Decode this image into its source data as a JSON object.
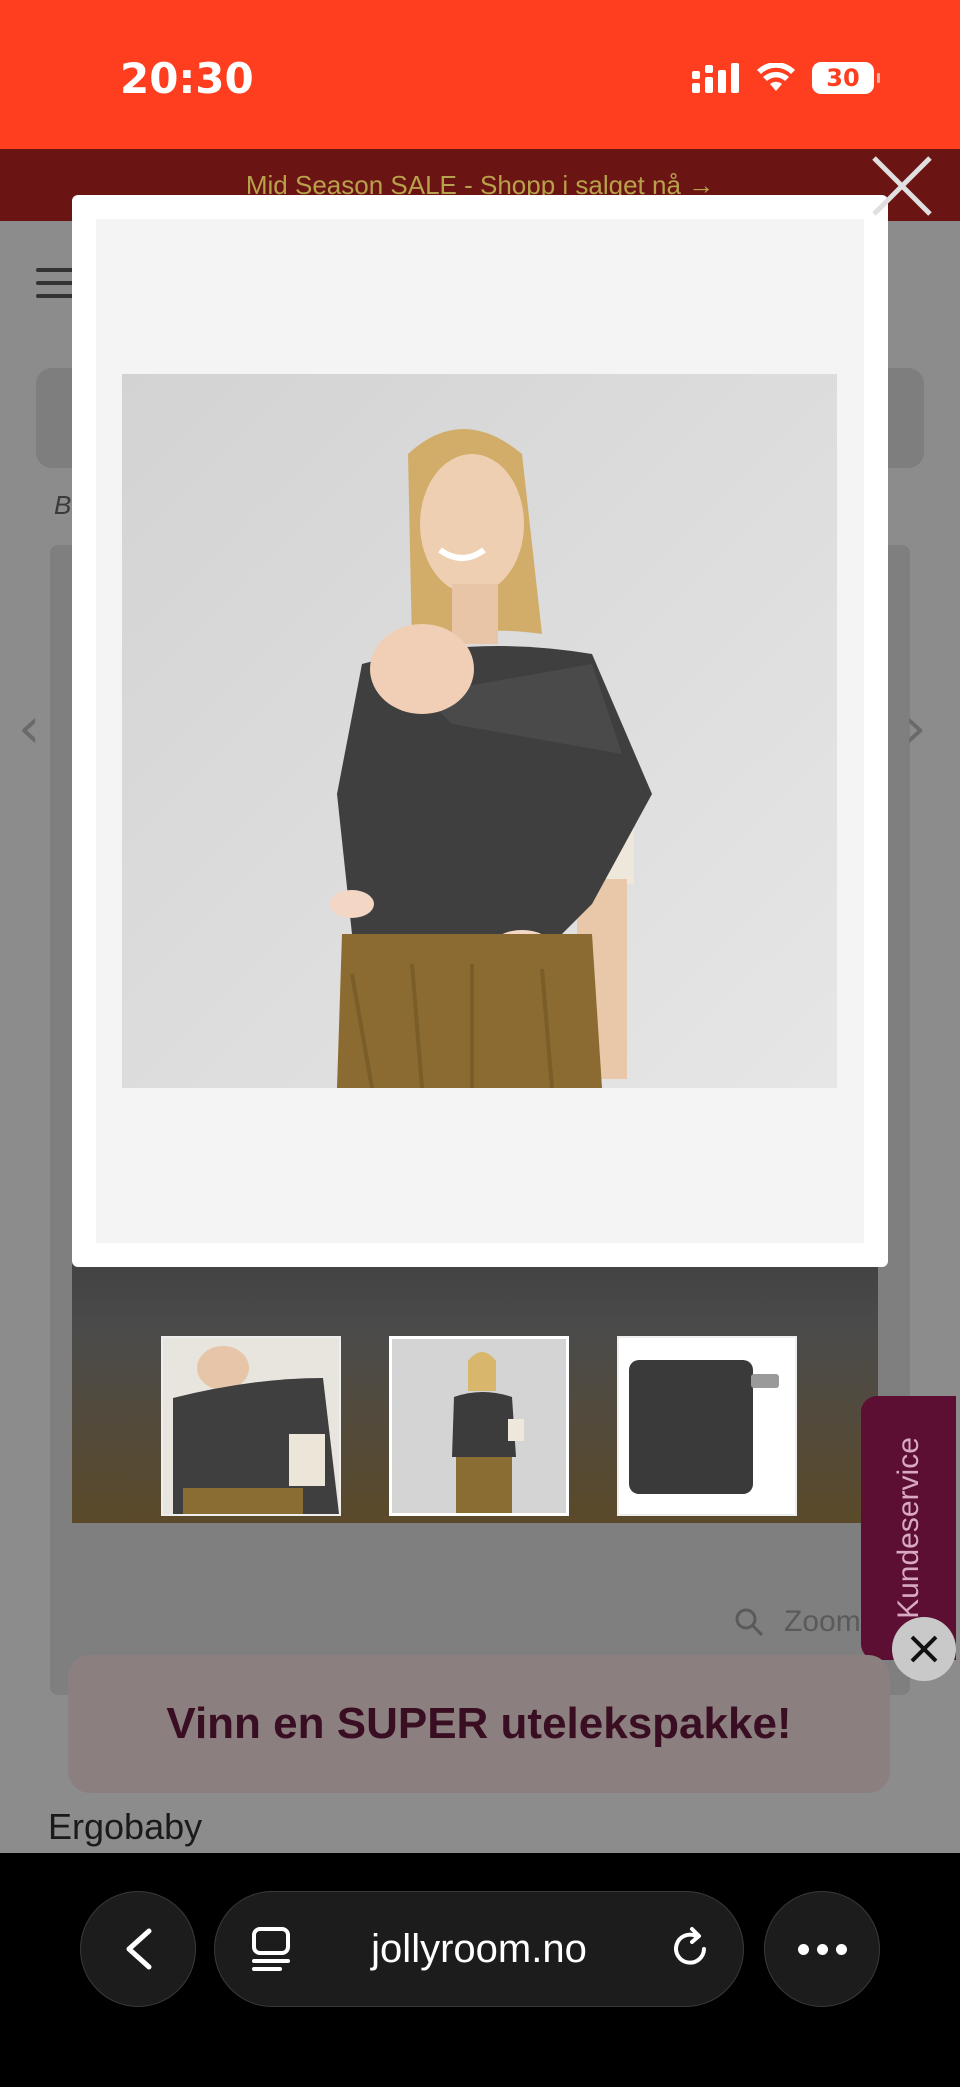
{
  "status_bar": {
    "time": "20:30",
    "battery": "30",
    "icons": [
      "signal-icon",
      "wifi-icon",
      "battery-icon"
    ],
    "color": "#ff3d1f"
  },
  "promo_banner": {
    "text": "Mid Season SALE - Shopp i salget nå →"
  },
  "page": {
    "breadcrumb": "B",
    "brand": "Ergobaby",
    "zoom_label": "Zoom",
    "gallery_thumbnails": [
      "front view",
      "model view",
      "pouch"
    ]
  },
  "customer_service_tab": {
    "label": "Kundeservice",
    "color": "#5c0f33"
  },
  "promo_popup": {
    "text": "Vinn en SUPER utelekspakke!",
    "text_color": "#3a0e22"
  },
  "lightbox": {
    "image_alt": "Woman wearing a dark grey baby wrap carrying a newborn"
  },
  "browser": {
    "url": "jollyroom.no",
    "icons": [
      "back-icon",
      "tabs-icon",
      "reload-icon",
      "more-icon"
    ]
  }
}
